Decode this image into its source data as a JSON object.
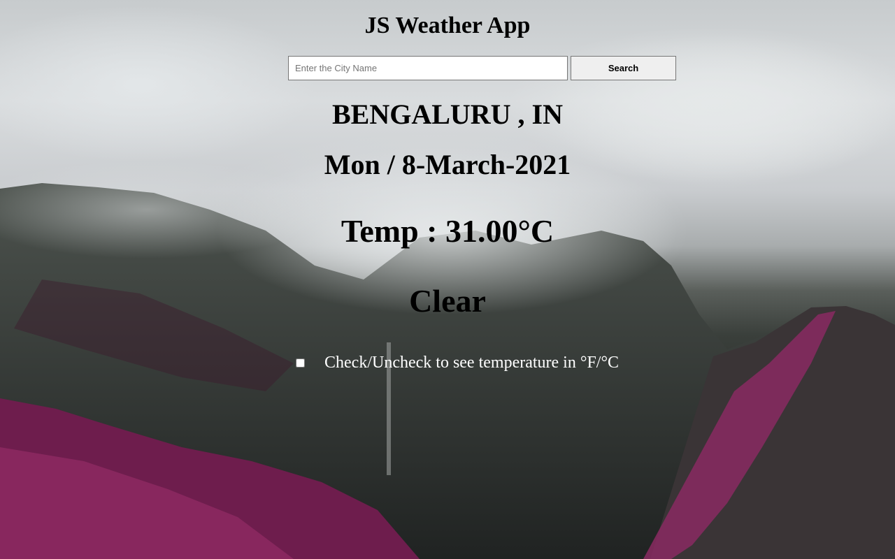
{
  "header": {
    "title": "JS Weather App"
  },
  "search": {
    "placeholder": "Enter the City Name",
    "value": "",
    "button_label": "Search"
  },
  "weather": {
    "location": "BENGALURU , IN",
    "date": "Mon / 8-March-2021",
    "temperature": "Temp : 31.00°C",
    "condition": "Clear"
  },
  "unit_toggle": {
    "checked": false,
    "label": "Check/Uncheck to see temperature in °F/°C"
  },
  "background": {
    "icon": "misty-mountain-landscape",
    "colors": {
      "sky": "#d9dcde",
      "mountain": "#2e332f",
      "foliage": "#7a1f55"
    }
  }
}
